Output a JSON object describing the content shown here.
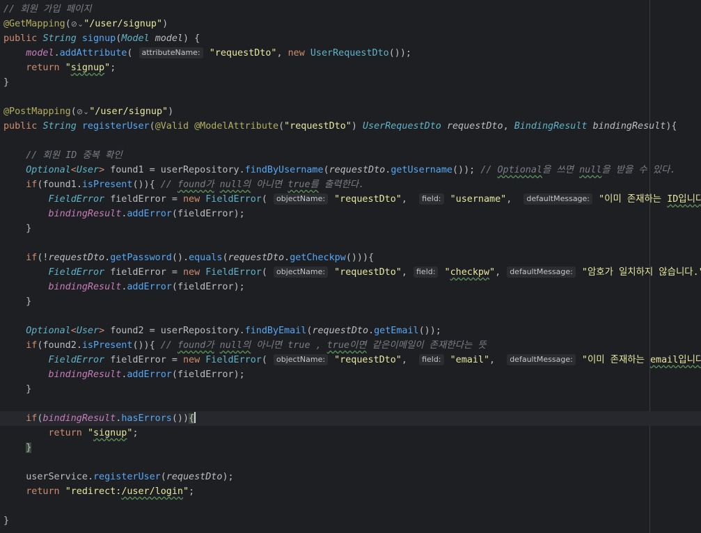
{
  "code": {
    "comment_signup_page": "// 회원 가입 페이지",
    "get_mapping": "@GetMapping",
    "post_mapping": "@PostMapping",
    "url_signup": "\"/user/signup\"",
    "kw_public": "public",
    "type_string": "String",
    "method_signup": "signup",
    "type_model": "Model",
    "param_model": "model",
    "method_add_attribute": "addAttribute",
    "hint_attribute_name": "attributeName:",
    "str_request_dto": "\"requestDto\"",
    "kw_new": "new",
    "class_user_request_dto": "UserRequestDto",
    "kw_return": "return",
    "str_signup_open": "\"",
    "str_signup_word": "signup",
    "str_signup_close": "\"",
    "method_register_user": "registerUser",
    "ann_valid": "@Valid",
    "ann_model_attribute": "@ModelAttribute",
    "param_request_dto": "requestDto",
    "type_binding_result": "BindingResult",
    "param_binding_result": "bindingResult",
    "comment_id_check": "// 회원 ID 중복 확인",
    "type_optional": "Optional",
    "type_user": "User",
    "var_found1": "found1",
    "var_found2": "found2",
    "field_user_repository": "userRepository",
    "method_find_by_username": "findByUsername",
    "method_get_username": "getUsername",
    "comment_optional_a": "// ",
    "comment_optional_b": "Optional",
    "comment_optional_c": "을 쓰면 ",
    "comment_optional_d": "null",
    "comment_optional_e": "을 받을 수 있다.",
    "kw_if": "if",
    "method_is_present": "isPresent",
    "comment_found1_a": "// ",
    "comment_found1_b": "found가",
    "comment_found1_c": " ",
    "comment_found1_d": "null의",
    "comment_found1_e": " 아니면 ",
    "comment_found1_f": "true를",
    "comment_found1_g": " 출력한다.",
    "type_field_error": "FieldError",
    "var_field_error": "fieldError",
    "hint_object_name": "objectName:",
    "hint_field": "field:",
    "hint_default_message": "defaultMessage:",
    "str_username": "\"username\"",
    "msg_id_a": "\"이미 존재하는 ",
    "msg_id_b": "ID입니다",
    "msg_id_c": ".\"",
    "method_add_error": "addError",
    "method_get_password": "getPassword",
    "method_equals": "equals",
    "method_get_checkpw": "getCheckpw",
    "str_checkpw_a": "\"",
    "str_checkpw_b": "checkpw",
    "str_checkpw_c": "\"",
    "msg_pw": "\"암호가 일치하지 않습니다.\"",
    "method_find_by_email": "findByEmail",
    "method_get_email": "getEmail",
    "comment_found2_a": "// ",
    "comment_found2_b": "found가",
    "comment_found2_c": " ",
    "comment_found2_d": "null의",
    "comment_found2_e": " 아니면 true , ",
    "comment_found2_f": "true이면",
    "comment_found2_g": " 같은이메일이 존재한다는 뜻",
    "str_email": "\"email\"",
    "msg_email_a": "\"이미 존재하는 ",
    "msg_email_b": "email입니다",
    "msg_email_c": ".\"",
    "method_has_errors": "hasErrors",
    "field_user_service": "userService",
    "str_redirect_a": "\"redirect:",
    "str_redirect_b": "/user/login",
    "str_redirect_c": "\"",
    "globe_icon": "⊘⌄"
  }
}
